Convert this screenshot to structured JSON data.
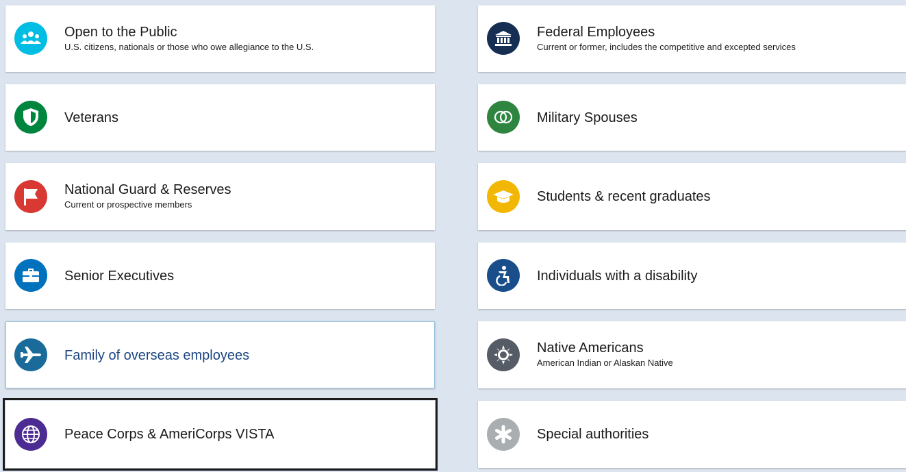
{
  "cards": [
    {
      "title": "Open to the Public",
      "subtitle": "U.S. citizens, nationals or those who owe allegiance to the U.S.",
      "icon": "people-group-icon",
      "color": "#00bde3"
    },
    {
      "title": "Federal Employees",
      "subtitle": "Current or former, includes the competitive and excepted services",
      "icon": "government-building-icon",
      "color": "#162e51"
    },
    {
      "title": "Veterans",
      "subtitle": "",
      "icon": "shield-icon",
      "color": "#00853f"
    },
    {
      "title": "Military Spouses",
      "subtitle": "",
      "icon": "rings-icon",
      "color": "#2e8540"
    },
    {
      "title": "National Guard & Reserves",
      "subtitle": "Current or prospective members",
      "icon": "flag-icon",
      "color": "#d83933"
    },
    {
      "title": "Students & recent graduates",
      "subtitle": "",
      "icon": "graduation-cap-icon",
      "color": "#f2b705"
    },
    {
      "title": "Senior Executives",
      "subtitle": "",
      "icon": "briefcase-icon",
      "color": "#0071bc"
    },
    {
      "title": "Individuals with a disability",
      "subtitle": "",
      "icon": "accessibility-icon",
      "color": "#1a4e8a"
    },
    {
      "title": "Family of overseas employees",
      "subtitle": "",
      "icon": "airplane-icon",
      "color": "#1a6b9a"
    },
    {
      "title": "Native Americans",
      "subtitle": "American Indian or Alaskan Native",
      "icon": "sun-icon",
      "color": "#565c65"
    },
    {
      "title": "Peace Corps & AmeriCorps VISTA",
      "subtitle": "",
      "icon": "globe-icon",
      "color": "#4c2c92"
    },
    {
      "title": "Special authorities",
      "subtitle": "",
      "icon": "asterisk-icon",
      "color": "#a9aeb1"
    }
  ]
}
